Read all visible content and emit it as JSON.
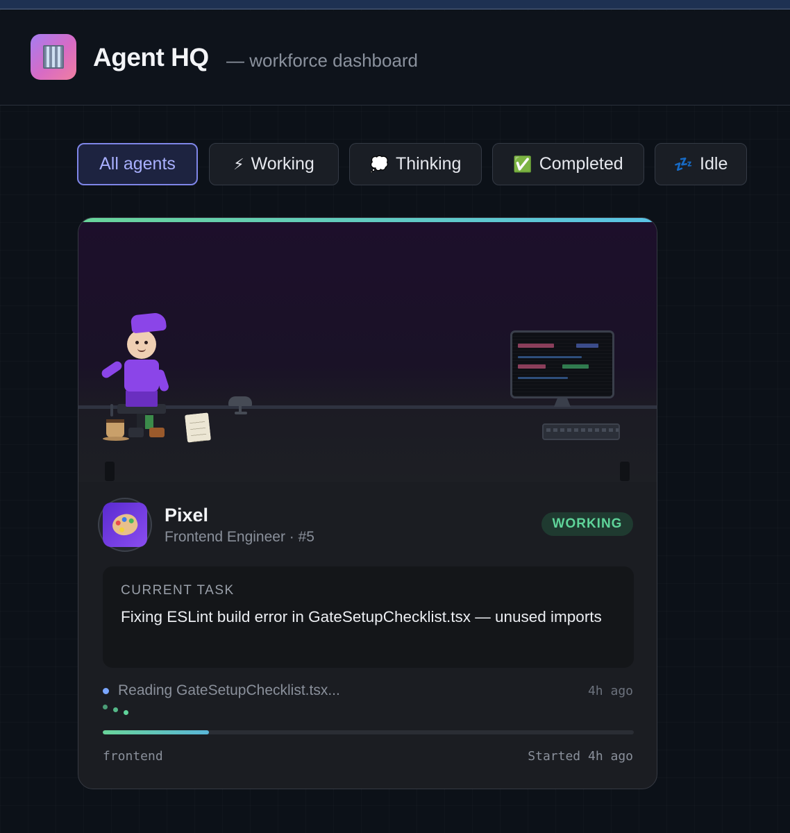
{
  "app": {
    "title": "Agent HQ",
    "subtitle": "— workforce dashboard",
    "logo_icon": "office-building-icon",
    "accent_color": "#7f86e8"
  },
  "filters": {
    "active": "All agents",
    "items": [
      {
        "label": "All agents",
        "icon": ""
      },
      {
        "label": "Working",
        "icon": "⚡"
      },
      {
        "label": "Thinking",
        "icon": "💭"
      },
      {
        "label": "Completed",
        "icon": "✅"
      },
      {
        "label": "Idle",
        "icon": "💤"
      }
    ]
  },
  "agent": {
    "name": "Pixel",
    "role": "Frontend Engineer · #5",
    "avatar_icon": "art-palette-icon",
    "status": "WORKING",
    "status_color": "#5fd49a",
    "task_label": "CURRENT TASK",
    "task_text": "Fixing ESLint build error in GateSetupChecklist.tsx — unused imports",
    "activity_text": "Reading GateSetupChecklist.tsx...",
    "activity_time": "4h ago",
    "progress": 0.2,
    "tag": "frontend",
    "started": "Started 4h ago"
  }
}
